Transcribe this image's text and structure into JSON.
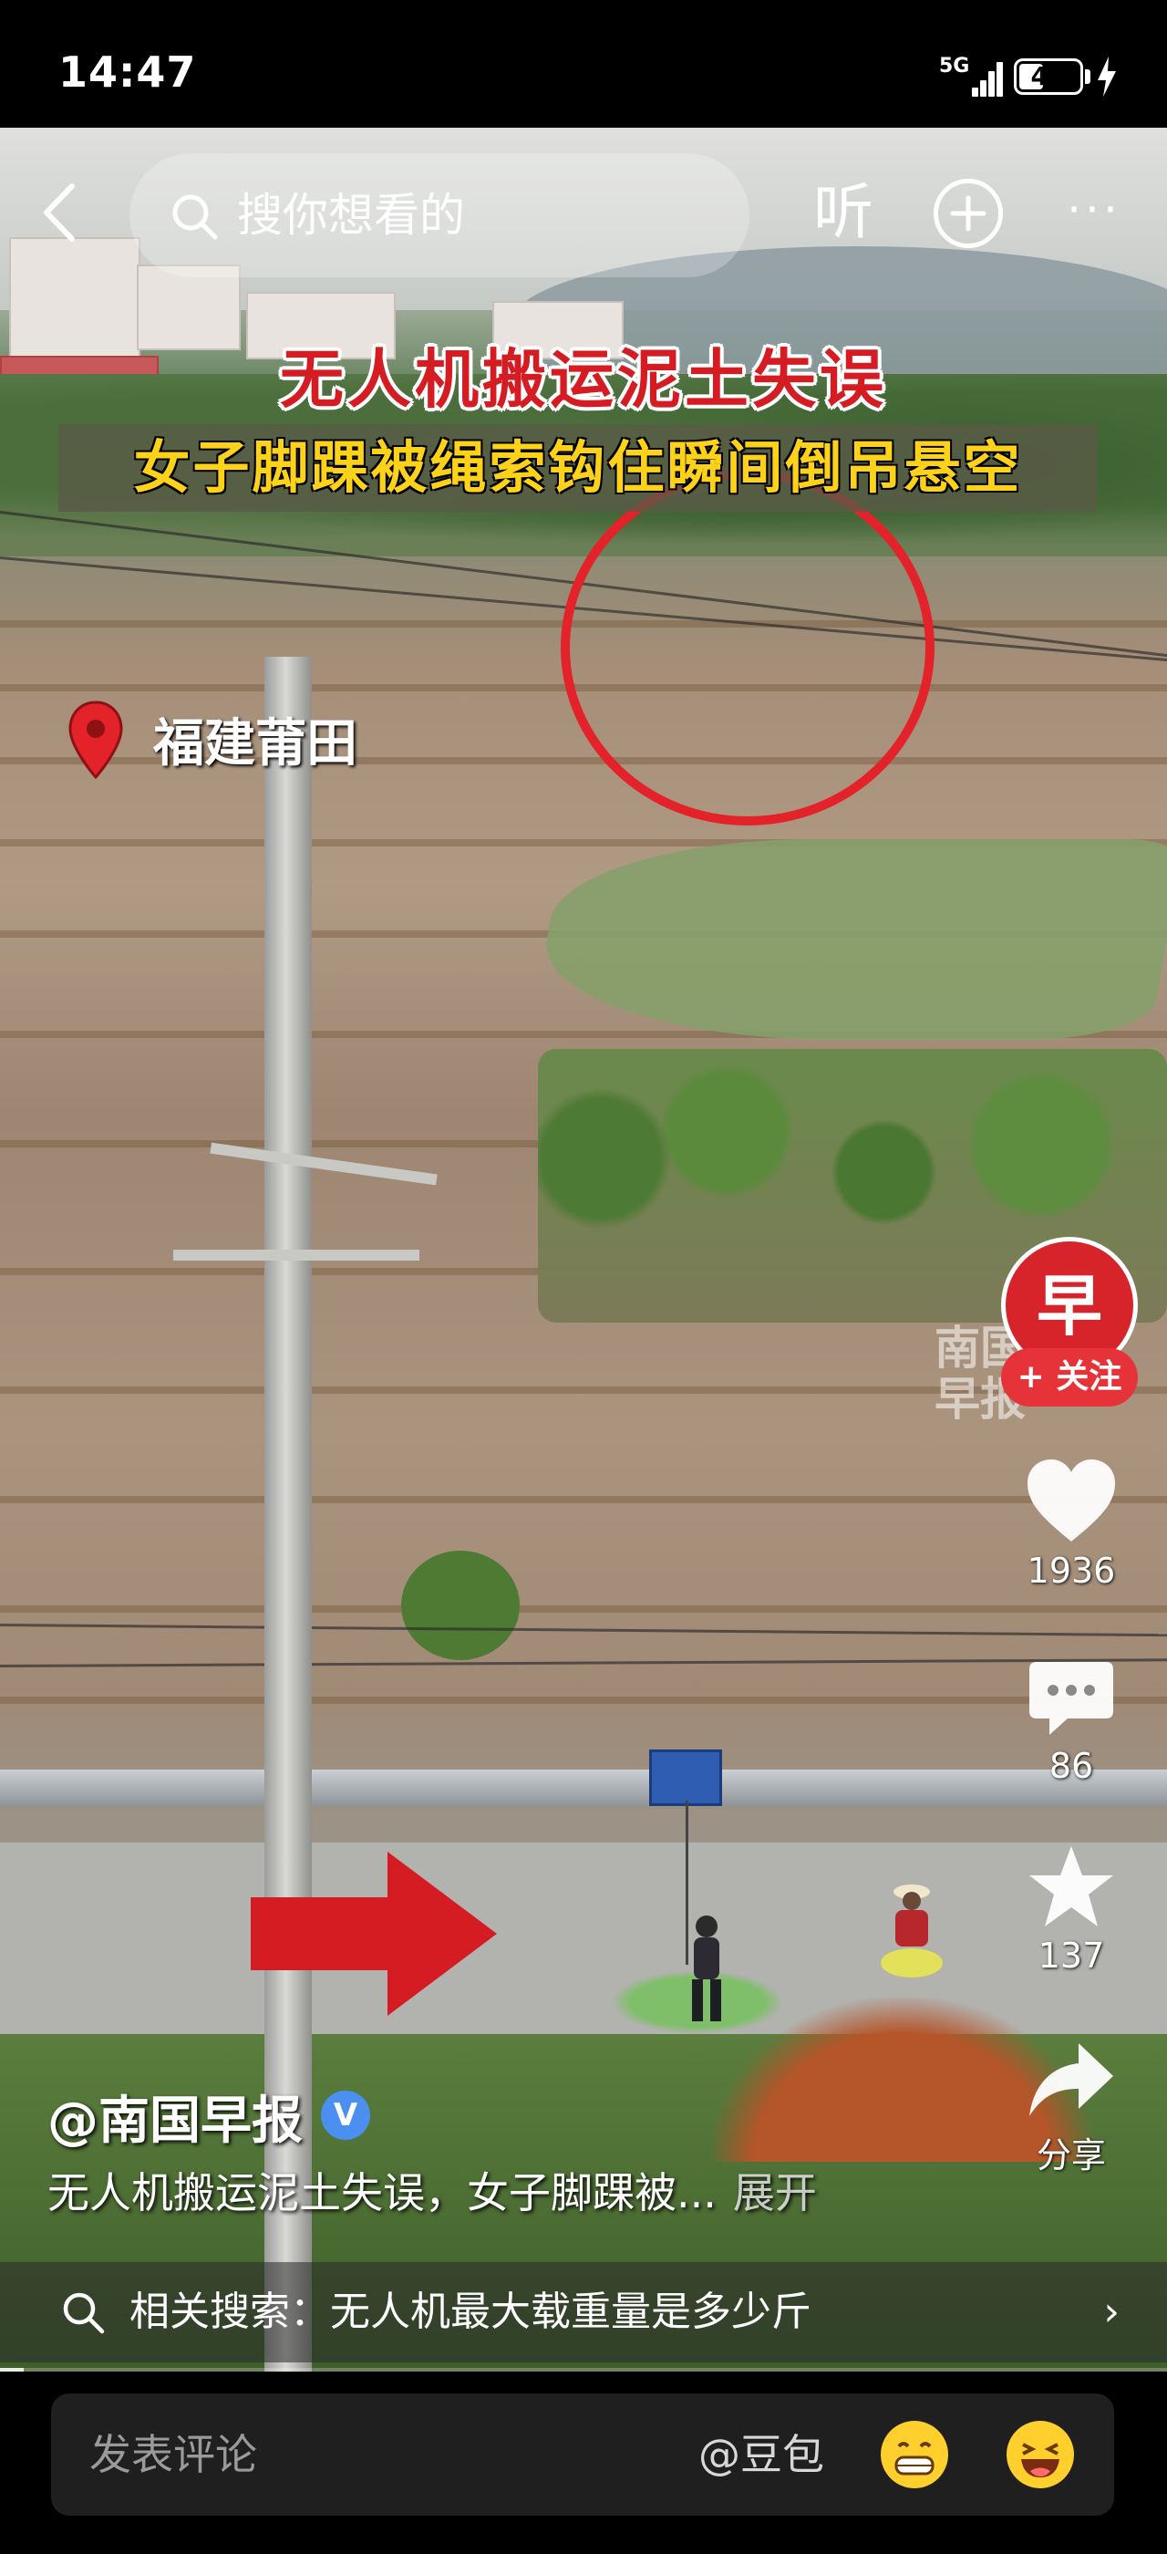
{
  "status_bar": {
    "time": "14:47",
    "network": "5G",
    "battery": "41",
    "battery_level_percent": 41
  },
  "top_nav": {
    "search_placeholder": "搜你想看的",
    "listen_label": "听",
    "more_label": "···"
  },
  "video": {
    "headline_1": "无人机搬运泥土失误",
    "headline_2": "女子脚踝被绳索钩住瞬间倒吊悬空",
    "location": "福建莆田",
    "watermark_line_1": "南国",
    "watermark_line_2": "早报",
    "progress_fraction": 0.02
  },
  "author": {
    "handle": "@南国早报",
    "verified_label": "V",
    "avatar_glyph": "早",
    "follow_label": "+ 关注"
  },
  "actions": {
    "likes": "1936",
    "comments": "86",
    "favorites": "137",
    "share_label": "分享"
  },
  "description": {
    "text": "无人机搬运泥土失误，女子脚踝被...",
    "expand_label": "展开"
  },
  "related_search": {
    "label": "相关搜索：无人机最大载重量是多少斤",
    "chevron": "›"
  },
  "comment_bar": {
    "placeholder": "发表评论",
    "mention_label": "@豆包"
  },
  "colors": {
    "accent_red": "#e6333a",
    "headline_yellow": "#ffd21a",
    "verified_blue": "#4b8ff0"
  },
  "icons": [
    "back-arrow-icon",
    "search-icon",
    "plus-circle-icon",
    "heart-icon",
    "comment-icon",
    "star-icon",
    "share-icon",
    "location-pin-icon",
    "chevron-right-icon",
    "grin-emoji-icon",
    "laugh-emoji-icon"
  ]
}
